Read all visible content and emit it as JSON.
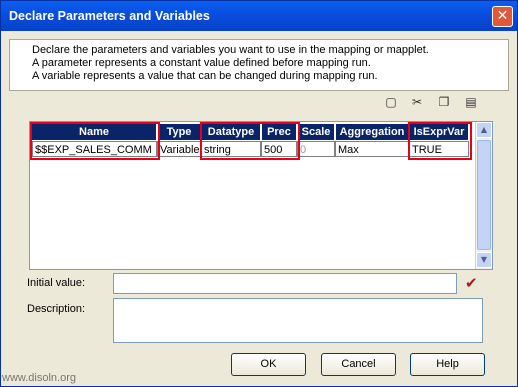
{
  "window": {
    "title": "Declare Parameters and Variables",
    "close_glyph": "✕"
  },
  "info": {
    "line1": "Declare the parameters and variables you want to use in the mapping or mapplet.",
    "line2": "A parameter represents a constant value defined before mapping run.",
    "line3": "A variable represents a value that can be changed during mapping run."
  },
  "toolbar": [
    {
      "name": "new-icon",
      "glyph": "▢"
    },
    {
      "name": "cut-icon",
      "glyph": "✂"
    },
    {
      "name": "copy-icon",
      "glyph": "❐"
    },
    {
      "name": "paste-icon",
      "glyph": "▤"
    }
  ],
  "grid": {
    "columns": [
      "Name",
      "Type",
      "Datatype",
      "Prec",
      "Scale",
      "Aggregation",
      "IsExprVar"
    ],
    "rows": [
      [
        "$$EXP_SALES_COMM",
        "Variable",
        "string",
        "500",
        "0",
        "Max",
        "TRUE"
      ]
    ]
  },
  "form": {
    "initial_value_label": "Initial value:",
    "initial_value": "",
    "description_label": "Description:",
    "description": "",
    "validate_glyph": "✔"
  },
  "buttons": {
    "ok": "OK",
    "cancel": "Cancel",
    "help": "Help"
  },
  "watermark": "www.disoln.org",
  "colors": {
    "header_bg": "#0a246a",
    "highlight_border": "#e8001a",
    "title_blue": "#0a50e0"
  }
}
